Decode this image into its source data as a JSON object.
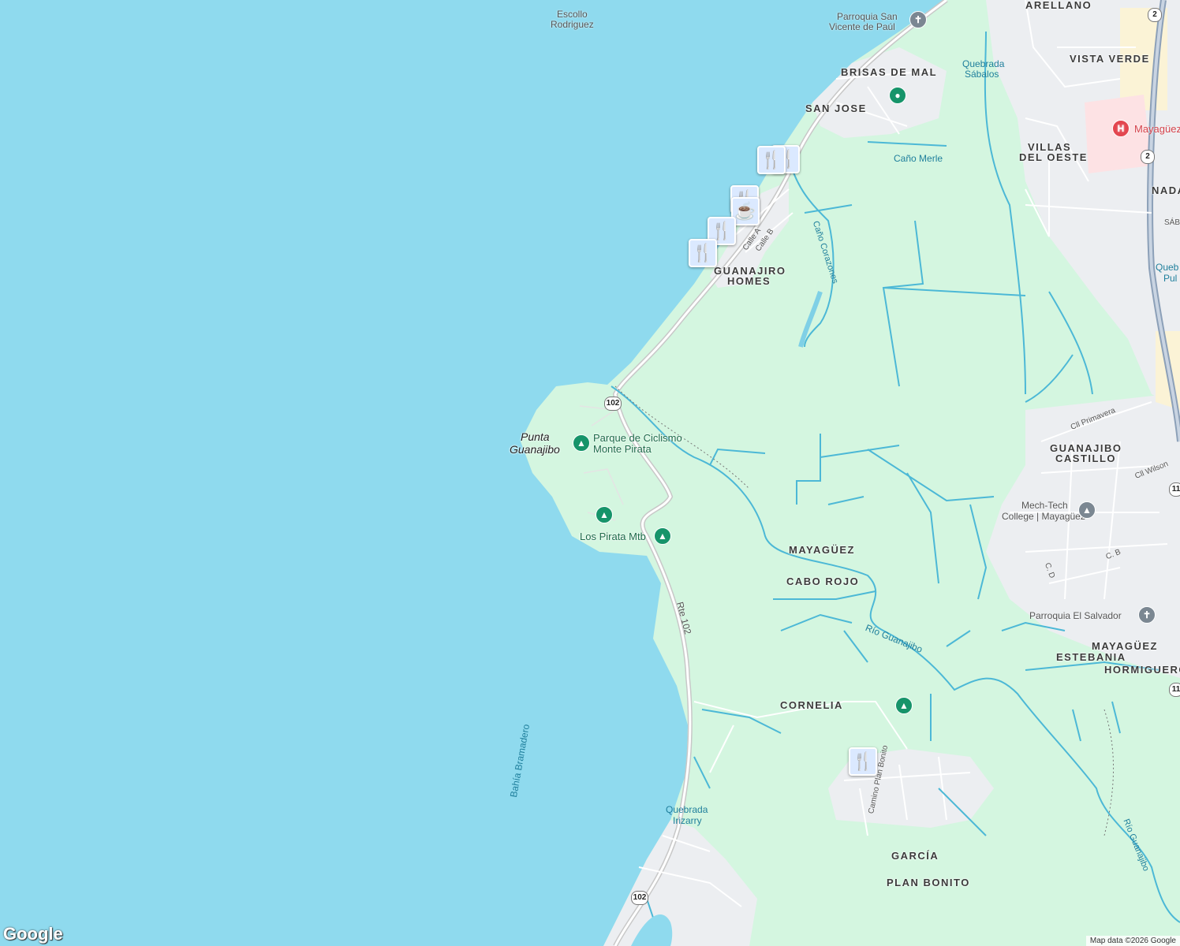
{
  "map": {
    "colors": {
      "water": "#8fdaee",
      "park": "#d4f6e0",
      "urban": "#eceef1",
      "road": "#ffffff",
      "river": "#4cb8d6",
      "highway": "#8ca0b8"
    },
    "neighborhoods": [
      {
        "id": "arellano",
        "text": "ARELLANO"
      },
      {
        "id": "vista-verde",
        "text": "VISTA VERDE"
      },
      {
        "id": "brisas",
        "text": "BRISAS DE MAL"
      },
      {
        "id": "san-jose",
        "text": "SAN JOSE"
      },
      {
        "id": "villas-line1",
        "text": "VILLAS"
      },
      {
        "id": "villas-line2",
        "text": "DEL OESTE"
      },
      {
        "id": "guanajiro-line1",
        "text": "GUANAJIRO"
      },
      {
        "id": "guanajiro-line2",
        "text": "HOMES"
      },
      {
        "id": "guanajibo-line1",
        "text": "GUANAJIBO"
      },
      {
        "id": "guanajibo-line2",
        "text": "CASTILLO"
      },
      {
        "id": "mayaguez-region",
        "text": "MAYAGÜEZ"
      },
      {
        "id": "cabo-rojo",
        "text": "CABO ROJO"
      },
      {
        "id": "mayaguez-estebania",
        "text": "MAYAGÜEZ"
      },
      {
        "id": "estebania",
        "text": "ESTEBANIA"
      },
      {
        "id": "hormigueros",
        "text": "HORMIGUEROS"
      },
      {
        "id": "cornelia",
        "text": "CORNELIA"
      },
      {
        "id": "garcia",
        "text": "GARCÍA"
      },
      {
        "id": "plan-bonito",
        "text": "PLAN BONITO"
      },
      {
        "id": "nada",
        "text": "NADA"
      }
    ],
    "pois": [
      {
        "id": "escollo-line1",
        "text": "Escollo"
      },
      {
        "id": "escollo-line2",
        "text": "Rodriguez"
      },
      {
        "id": "parroquia-sv-line1",
        "text": "Parroquia San"
      },
      {
        "id": "parroquia-sv-line2",
        "text": "Vicente de Paúl"
      },
      {
        "id": "quebrada-sab-line1",
        "text": "Quebrada"
      },
      {
        "id": "quebrada-sab-line2",
        "text": "Sábalos"
      },
      {
        "id": "hospital",
        "text": "Mayagüez"
      },
      {
        "id": "cano-merle",
        "text": "Caño Merle"
      },
      {
        "id": "parque-line1",
        "text": "Parque de Ciclismo"
      },
      {
        "id": "parque-line2",
        "text": "Monte Pirata"
      },
      {
        "id": "los-pirata",
        "text": "Los Pirata Mtb"
      },
      {
        "id": "mechtech-line1",
        "text": "Mech-Tech"
      },
      {
        "id": "mechtech-line2",
        "text": "College | Mayagüez"
      },
      {
        "id": "parroquia-salvador",
        "text": "Parroquia El Salvador"
      },
      {
        "id": "quebrada-iri-line1",
        "text": "Quebrada"
      },
      {
        "id": "quebrada-iri-line2",
        "text": "Irizarry"
      },
      {
        "id": "quebrada-pul-line1",
        "text": "Queb"
      },
      {
        "id": "quebrada-pul-line2",
        "text": "Pul"
      }
    ],
    "places": [
      {
        "id": "punta-line1",
        "text": "Punta"
      },
      {
        "id": "punta-line2",
        "text": "Guanajibo"
      }
    ],
    "waters": [
      {
        "id": "bahia",
        "text": "Bahía Bramadero"
      },
      {
        "id": "cano-corazones",
        "text": "Caño Corazones"
      },
      {
        "id": "rio-guanajibo",
        "text": "Río Guanajibo"
      },
      {
        "id": "rio-right",
        "text": "Río Guanajibo"
      }
    ],
    "streets": [
      {
        "id": "calle-a",
        "text": "Calle A"
      },
      {
        "id": "calle-b",
        "text": "Calle B"
      },
      {
        "id": "cll-primavera",
        "text": "Cll Primavera"
      },
      {
        "id": "cll-wilson",
        "text": "Cll Wilson"
      },
      {
        "id": "c-b",
        "text": "C. B"
      },
      {
        "id": "c-d",
        "text": "C. D"
      },
      {
        "id": "camino-plan-bonito",
        "text": "Camino Plan Bonito"
      },
      {
        "id": "rte-102",
        "text": "Rte 102"
      },
      {
        "id": "sab",
        "text": "SÁB"
      }
    ],
    "shields": [
      {
        "id": "s102-top",
        "text": "102"
      },
      {
        "id": "s102-bottom",
        "text": "102"
      },
      {
        "id": "s2-top",
        "text": "2"
      },
      {
        "id": "s2-mid",
        "text": "2"
      },
      {
        "id": "s11-a",
        "text": "11"
      },
      {
        "id": "s11-b",
        "text": "11"
      }
    ],
    "icons": {
      "restaurant": "restaurant-icon",
      "cafe": "cafe-icon",
      "park": "park-icon",
      "church": "church-icon",
      "school": "school-icon",
      "hospital": "hospital-icon"
    },
    "logo": "Google",
    "attribution": "Map data ©2026 Google"
  }
}
